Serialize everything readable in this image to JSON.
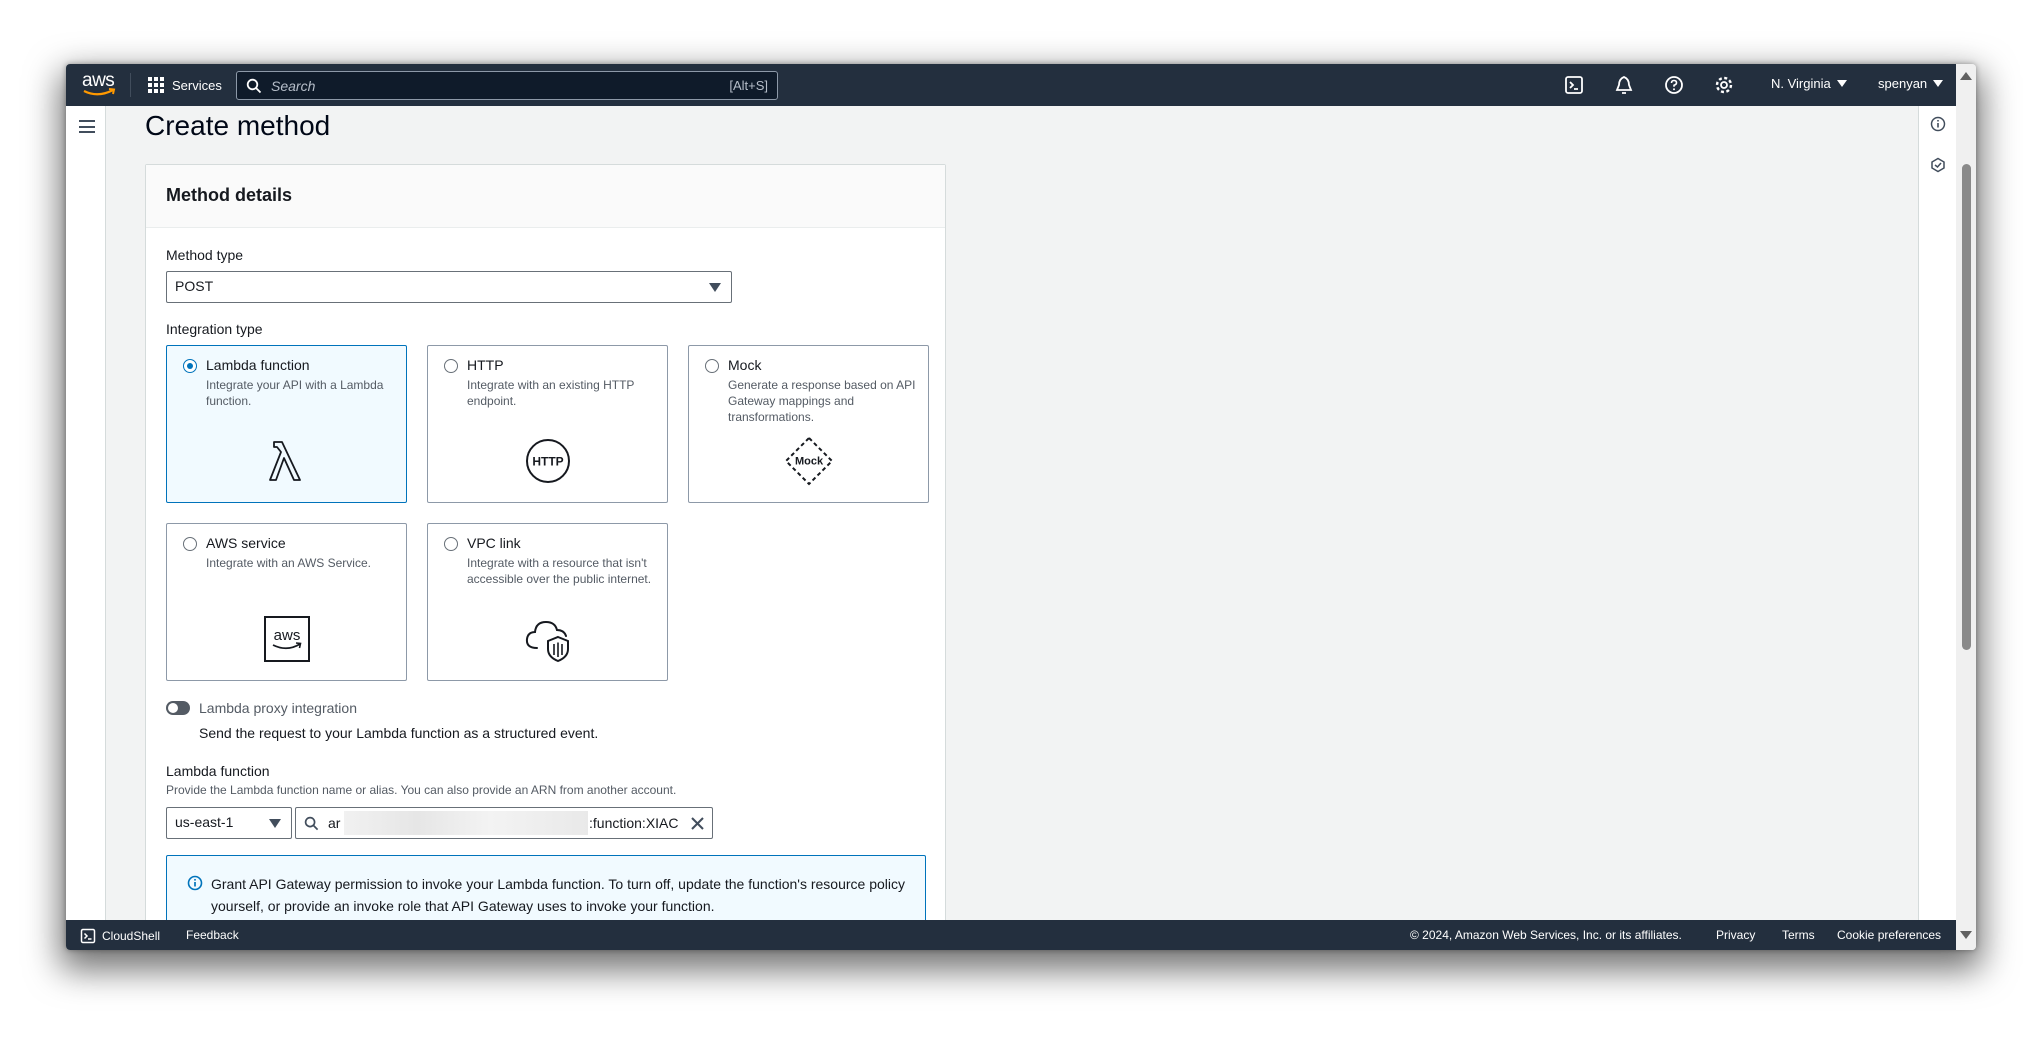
{
  "nav": {
    "logo_text": "aws",
    "services_label": "Services",
    "search_placeholder": "Search",
    "search_shortcut": "[Alt+S]",
    "region": "N. Virginia",
    "user": "spenyan"
  },
  "page": {
    "title": "Create method"
  },
  "panel": {
    "heading": "Method details",
    "method_type_label": "Method type",
    "method_type_value": "POST",
    "integration_type_label": "Integration type",
    "integration_options": [
      {
        "title": "Lambda function",
        "description": "Integrate your API with a Lambda function.",
        "selected": true,
        "icon": "lambda-icon"
      },
      {
        "title": "HTTP",
        "description": "Integrate with an existing HTTP endpoint.",
        "selected": false,
        "icon": "http-icon",
        "icon_text": "HTTP"
      },
      {
        "title": "Mock",
        "description": "Generate a response based on API Gateway mappings and transformations.",
        "selected": false,
        "icon": "mock-icon",
        "icon_text": "Mock"
      },
      {
        "title": "AWS service",
        "description": "Integrate with an AWS Service.",
        "selected": false,
        "icon": "aws-service-icon",
        "icon_text": "aws"
      },
      {
        "title": "VPC link",
        "description": "Integrate with a resource that isn't accessible over the public internet.",
        "selected": false,
        "icon": "vpc-link-icon"
      }
    ],
    "proxy_label": "Lambda proxy integration",
    "proxy_description": "Send the request to your Lambda function as a structured event.",
    "proxy_enabled": false,
    "lambda_label": "Lambda function",
    "lambda_hint": "Provide the Lambda function name or alias. You can also provide an ARN from another account.",
    "lambda_region": "us-east-1",
    "lambda_arn_prefix": "ar",
    "lambda_arn_suffix": ":function:XIAC",
    "alert_text": "Grant API Gateway permission to invoke your Lambda function. To turn off, update the function's resource policy yourself, or provide an invoke role that API Gateway uses to invoke your function."
  },
  "footer": {
    "cloudshell": "CloudShell",
    "feedback": "Feedback",
    "copyright": "© 2024, Amazon Web Services, Inc. or its affiliates.",
    "privacy": "Privacy",
    "terms": "Terms",
    "cookies": "Cookie preferences"
  },
  "colors": {
    "nav_bg": "#232f3e",
    "accent": "#0073bb",
    "selected_bg": "#f1faff"
  }
}
